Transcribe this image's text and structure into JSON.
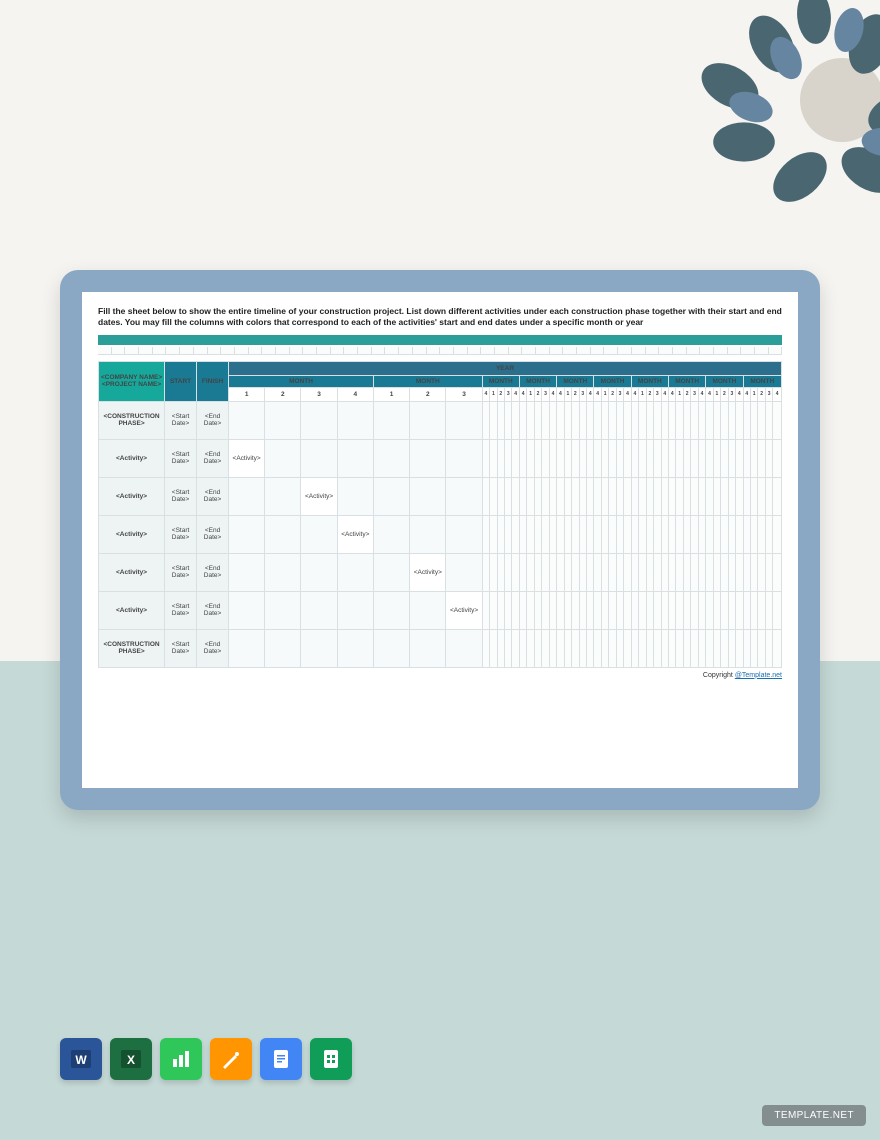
{
  "instructions": "Fill the sheet below to show the entire timeline of your construction project. List down different activities under each construction phase together with their start and end dates. You may fill the columns with colors that correspond to each of the activities' start and end dates under a specific month or year",
  "header": {
    "company": "<COMPANY NAME>",
    "project": "<PROJECT NAME>",
    "start": "START",
    "finish": "FINISH",
    "year": "YEAR",
    "month": "MONTH"
  },
  "days_large": [
    "1",
    "2",
    "3",
    "4",
    "1",
    "2",
    "3"
  ],
  "days_small_group": [
    "4",
    "1",
    "2",
    "3",
    "4"
  ],
  "rows": [
    {
      "label": "<CONSTRUCTION PHASE>",
      "start": "<Start Date>",
      "end": "<End Date>",
      "activity_col": -1
    },
    {
      "label": "<Activity>",
      "start": "<Start Date>",
      "end": "<End Date>",
      "activity_col": 0
    },
    {
      "label": "<Activity>",
      "start": "<Start Date>",
      "end": "<End Date>",
      "activity_col": 2
    },
    {
      "label": "<Activity>",
      "start": "<Start Date>",
      "end": "<End Date>",
      "activity_col": 3
    },
    {
      "label": "<Activity>",
      "start": "<Start Date>",
      "end": "<End Date>",
      "activity_col": 5
    },
    {
      "label": "<Activity>",
      "start": "<Start Date>",
      "end": "<End Date>",
      "activity_col": 6
    },
    {
      "label": "<CONSTRUCTION PHASE>",
      "start": "<Start Date>",
      "end": "<End Date>",
      "activity_col": -1
    }
  ],
  "activity_placeholder": "<Activity>",
  "copyright": {
    "text": "Copyright ",
    "link": "@Template.net"
  },
  "icons": [
    "word",
    "excel",
    "numbers",
    "pages",
    "docs",
    "sheets"
  ],
  "watermark": "TEMPLATE.NET"
}
